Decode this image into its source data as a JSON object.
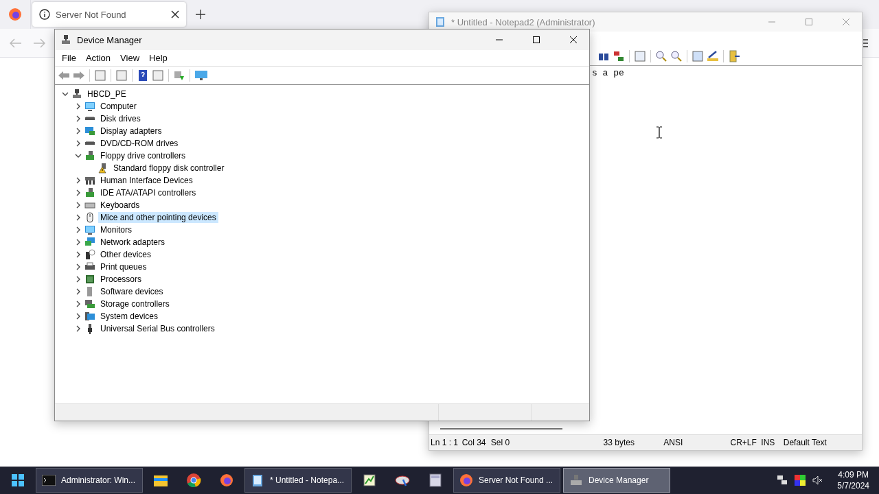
{
  "browser": {
    "tabs": [
      {
        "title": "Server Not Found",
        "selected": true
      }
    ]
  },
  "notepad": {
    "title": "* Untitled - Notepad2 (Administrator)",
    "text": "s a pe",
    "status": [
      "Ln 1 : 1",
      "Col 34",
      "Sel 0",
      "33 bytes",
      "ANSI",
      "CR+LF",
      "INS",
      "Default Text"
    ]
  },
  "device_manager": {
    "title": "Device Manager",
    "menu": [
      "File",
      "Action",
      "View",
      "Help"
    ],
    "tree": {
      "label": "HBCD_PE",
      "kind": "computer-root",
      "expanded": true,
      "children": [
        {
          "label": "Computer",
          "kind": "monitor",
          "expanded": false,
          "selected": false
        },
        {
          "label": "Disk drives",
          "kind": "drive",
          "expanded": false,
          "selected": false
        },
        {
          "label": "Display adapters",
          "kind": "display",
          "expanded": false,
          "selected": false
        },
        {
          "label": "DVD/CD-ROM drives",
          "kind": "drive",
          "expanded": false,
          "selected": false
        },
        {
          "label": "Floppy drive controllers",
          "kind": "controller",
          "expanded": true,
          "selected": false,
          "children": [
            {
              "label": "Standard floppy disk controller",
              "kind": "warning",
              "selected": false
            }
          ]
        },
        {
          "label": "Human Interface Devices",
          "kind": "hid",
          "expanded": false,
          "selected": false
        },
        {
          "label": "IDE ATA/ATAPI controllers",
          "kind": "controller",
          "expanded": false,
          "selected": false
        },
        {
          "label": "Keyboards",
          "kind": "keyboard",
          "expanded": false,
          "selected": false
        },
        {
          "label": "Mice and other pointing devices",
          "kind": "mouse",
          "expanded": false,
          "selected": true
        },
        {
          "label": "Monitors",
          "kind": "monitor",
          "expanded": false,
          "selected": false
        },
        {
          "label": "Network adapters",
          "kind": "network",
          "expanded": false,
          "selected": false
        },
        {
          "label": "Other devices",
          "kind": "unknown",
          "expanded": false,
          "selected": false
        },
        {
          "label": "Print queues",
          "kind": "printer",
          "expanded": false,
          "selected": false
        },
        {
          "label": "Processors",
          "kind": "chip",
          "expanded": false,
          "selected": false
        },
        {
          "label": "Software devices",
          "kind": "software",
          "expanded": false,
          "selected": false
        },
        {
          "label": "Storage controllers",
          "kind": "storage",
          "expanded": false,
          "selected": false
        },
        {
          "label": "System devices",
          "kind": "system",
          "expanded": false,
          "selected": false
        },
        {
          "label": "Universal Serial Bus controllers",
          "kind": "usb",
          "expanded": false,
          "selected": false
        }
      ]
    }
  },
  "taskbar": {
    "items": [
      {
        "kind": "start",
        "selected": false
      },
      {
        "kind": "terminal",
        "label": "Administrator: Win...",
        "selected": false
      },
      {
        "kind": "folder",
        "selected": false
      },
      {
        "kind": "chrome",
        "selected": false
      },
      {
        "kind": "firefox",
        "selected": false
      },
      {
        "kind": "notepad",
        "label": "* Untitled - Notepa...",
        "selected": false
      },
      {
        "kind": "chart",
        "selected": false
      },
      {
        "kind": "tool",
        "selected": false
      },
      {
        "kind": "calculator",
        "selected": false
      },
      {
        "kind": "firefox",
        "label": "Server Not Found ...",
        "selected": false
      },
      {
        "kind": "devmgr",
        "label": "Device Manager",
        "selected": true
      }
    ],
    "clock": {
      "time": "4:09 PM",
      "date": "5/7/2024"
    }
  }
}
